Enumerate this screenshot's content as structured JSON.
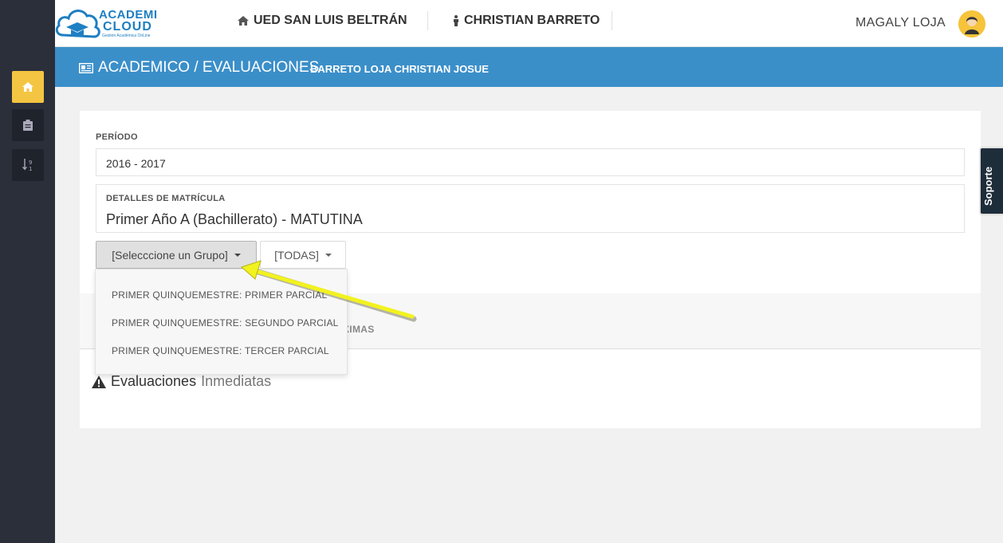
{
  "logo": {
    "line1": "ACADEMI",
    "line2": "CLOUD",
    "tagline": "Gestión Académica OnLine"
  },
  "header": {
    "institution": "UED SAN LUIS BELTRÁN",
    "student": "CHRISTIAN BARRETO",
    "user": "MAGALY LOJA"
  },
  "breadcrumb": {
    "section": "ACADEMICO / EVALUACIONES",
    "student": "BARRETO LOJA CHRISTIAN JOSUE"
  },
  "form": {
    "period_label": "PERÍODO",
    "period_value": "2016 - 2017",
    "enrollment_label": "DETALLES DE MATRÍCULA",
    "enrollment_value": "Primer Año A (Bachillerato) - MATUTINA",
    "group_select": "[Selecccione un Grupo]",
    "filter_select": "[TODAS]"
  },
  "dropdown": {
    "items": [
      "PRIMER QUINQUEMESTRE: PRIMER PARCIAL",
      "PRIMER QUINQUEMESTRE: SEGUNDO PARCIAL",
      "PRIMER QUINQUEMESTRE: TERCER PARCIAL"
    ]
  },
  "tabs": {
    "partial_label": "XIMAS"
  },
  "evaluations": {
    "title_bold": "Evaluaciones",
    "title_light": "Inmediatas"
  },
  "support": {
    "label": "Soporte"
  },
  "icons": {
    "sidebar": [
      "home-icon",
      "clipboard-icon",
      "sort-numeric-icon"
    ],
    "header": [
      "home-icon",
      "male-icon"
    ],
    "breadcrumb": "newspaper-icon",
    "evaluations": "warning-icon"
  },
  "colors": {
    "accent": "#f4c542",
    "brand": "#3b8fc9",
    "sidebar": "#2b2f3a",
    "annotation": "#f2f21f"
  }
}
